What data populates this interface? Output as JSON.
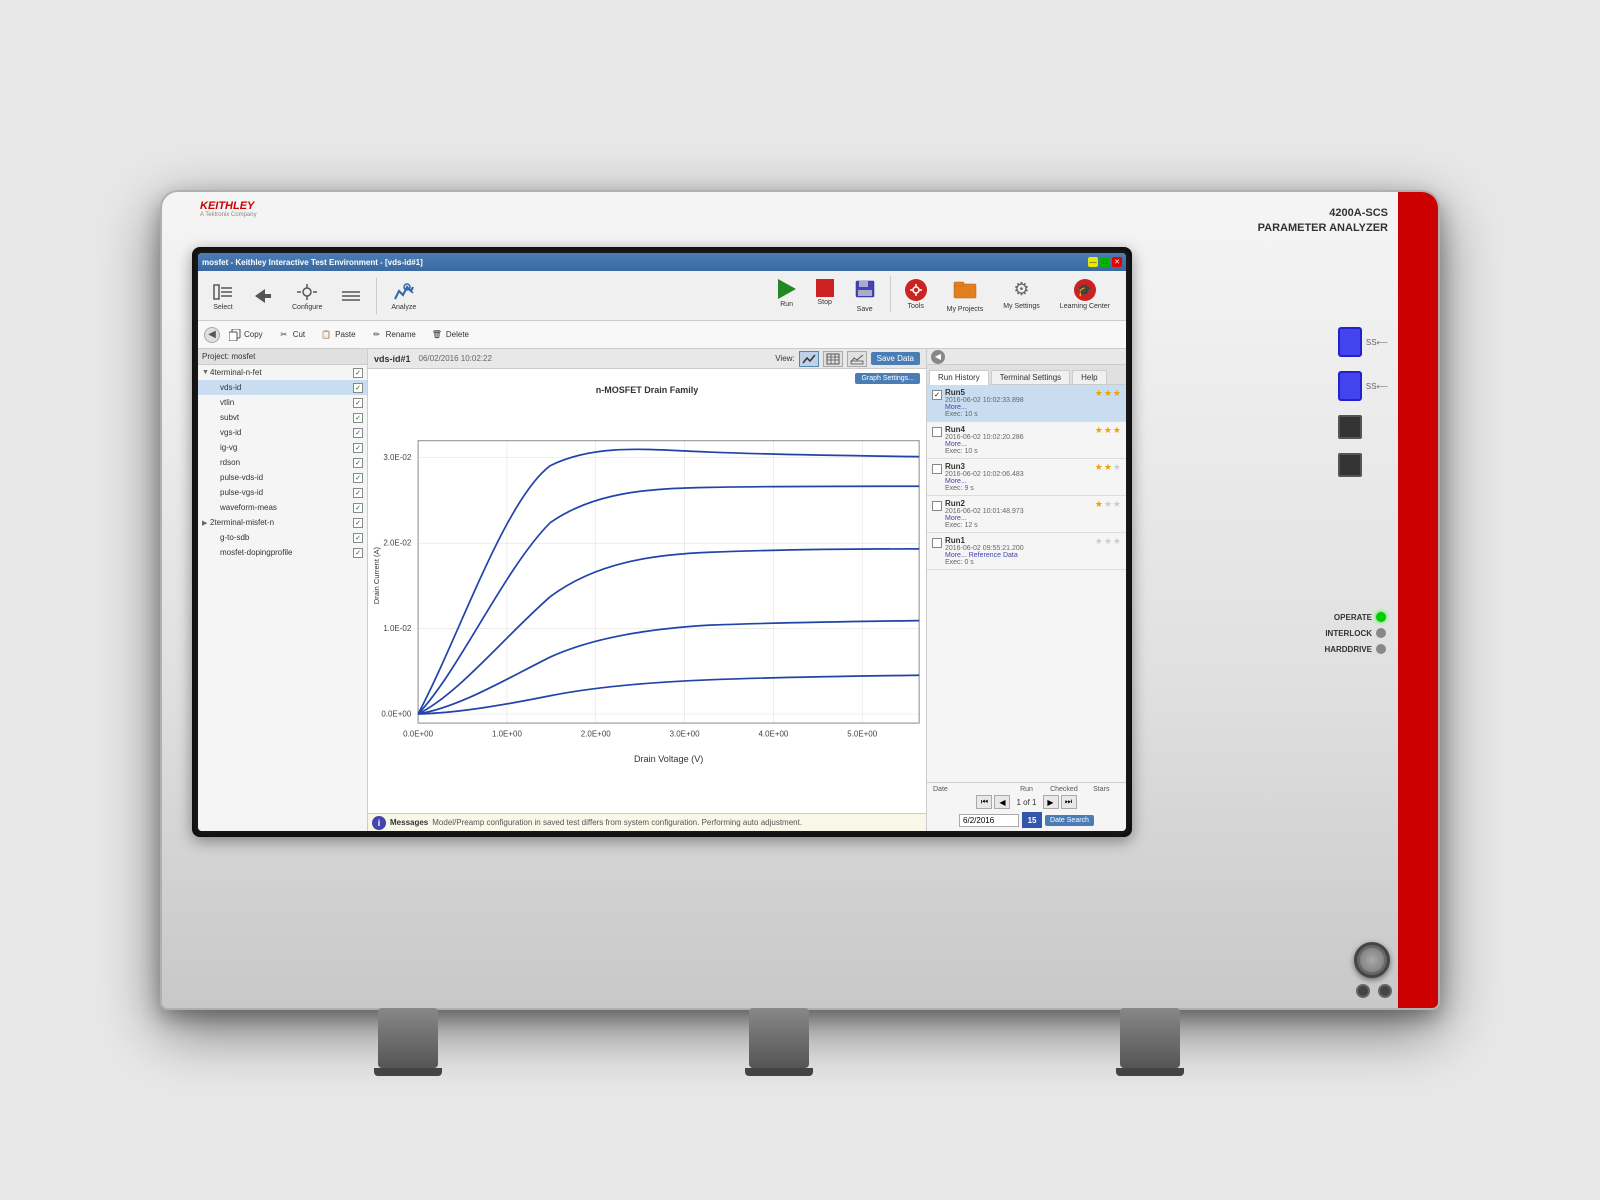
{
  "instrument": {
    "model": "4200A-SCS",
    "subtitle": "PARAMETER ANALYZER"
  },
  "titlebar": {
    "text": "mosfet - Keithley Interactive Test Environment - [vds-id#1]",
    "minimize": "—",
    "maximize": "□",
    "close": "✕"
  },
  "toolbar": {
    "select_label": "Select",
    "configure_label": "Configure",
    "analyze_label": "Analyze",
    "run_label": "Run",
    "stop_label": "Stop",
    "save_label": "Save",
    "tools_label": "Tools",
    "myprojects_label": "My Projects",
    "mysettings_label": "My Settings",
    "learningcenter_label": "Learning Center"
  },
  "toolbar2": {
    "copy_label": "Copy",
    "cut_label": "Cut",
    "paste_label": "Paste",
    "rename_label": "Rename",
    "delete_label": "Delete"
  },
  "graph": {
    "title": "vds-id#1",
    "date": "06/02/2016 10:02:22",
    "chart_title": "n-MOSFET Drain Family",
    "y_axis_label": "Drain Current (A)",
    "x_axis_label": "Drain Voltage (V)",
    "view_label": "View:",
    "save_data_btn": "Save Data",
    "graph_settings_btn": "Graph Settings...",
    "y_ticks": [
      "3.0E-02",
      "2.0E-02",
      "1.0E-02",
      "0.0E+00"
    ],
    "x_ticks": [
      "0.0E+00",
      "1.0E+00",
      "2.0E+00",
      "3.0E+00",
      "4.0E+00",
      "5.0E+00"
    ]
  },
  "left_panel": {
    "project_label": "Project: mosfet",
    "items": [
      {
        "label": "4terminal-n-fet",
        "indent": 1,
        "type": "folder",
        "expanded": true,
        "checked": true
      },
      {
        "label": "vds-id",
        "indent": 2,
        "type": "item",
        "checked": true,
        "selected": true
      },
      {
        "label": "vtlin",
        "indent": 2,
        "type": "item",
        "checked": true
      },
      {
        "label": "subvt",
        "indent": 2,
        "type": "item",
        "checked": true
      },
      {
        "label": "vgs-id",
        "indent": 2,
        "type": "item",
        "checked": true
      },
      {
        "label": "ig-vg",
        "indent": 2,
        "type": "item",
        "checked": true
      },
      {
        "label": "rdson",
        "indent": 2,
        "type": "item",
        "checked": true
      },
      {
        "label": "pulse-vds-id",
        "indent": 2,
        "type": "item",
        "checked": true
      },
      {
        "label": "pulse-vgs-id",
        "indent": 2,
        "type": "item",
        "checked": true
      },
      {
        "label": "waveform-meas",
        "indent": 2,
        "type": "item",
        "checked": true
      },
      {
        "label": "2terminal-misfet-n",
        "indent": 1,
        "type": "folder",
        "expanded": false,
        "checked": true
      },
      {
        "label": "g-to-sdb",
        "indent": 2,
        "type": "item",
        "checked": true
      },
      {
        "label": "mosfet-dopingprofile",
        "indent": 2,
        "type": "item",
        "checked": true
      }
    ]
  },
  "run_history": {
    "tab_run_history": "Run History",
    "tab_terminal": "Terminal Settings",
    "tab_help": "Help",
    "runs": [
      {
        "name": "Run5",
        "date": "2016-06-02 10:02:33.898",
        "more": "More...",
        "exec": "Exec: 10 s",
        "stars": 3,
        "checked": true
      },
      {
        "name": "Run4",
        "date": "2016-06-02 10:02:20.286",
        "more": "More...",
        "exec": "Exec: 10 s",
        "stars": 3,
        "checked": false
      },
      {
        "name": "Run3",
        "date": "2016-06-02 10:02:06.483",
        "more": "More...",
        "exec": "Exec: 9 s",
        "stars": 2,
        "checked": false
      },
      {
        "name": "Run2",
        "date": "2016-06-02 10:01:48.973",
        "more": "More...",
        "exec": "Exec: 12 s",
        "stars": 1,
        "checked": false
      },
      {
        "name": "Run1",
        "date": "2016-06-02 09:55:21.200",
        "more": "More... Reference Data",
        "exec": "Exec: 0 s",
        "stars": 0,
        "checked": false
      }
    ],
    "col_date": "Date",
    "col_run": "Run",
    "col_checked": "Checked",
    "col_stars": "Stars",
    "pagination_text": "1 of 1",
    "date_value": "6/2/2016",
    "date_num": "15",
    "date_search_btn": "Date Search"
  },
  "messages": {
    "label": "Messages",
    "text": "Model/Preamp configuration in saved test differs from system configuration. Performing auto adjustment."
  },
  "indicators": {
    "operate": "OPERATE",
    "interlock": "INTERLOCK",
    "harddrive": "HARDDRIVE"
  }
}
